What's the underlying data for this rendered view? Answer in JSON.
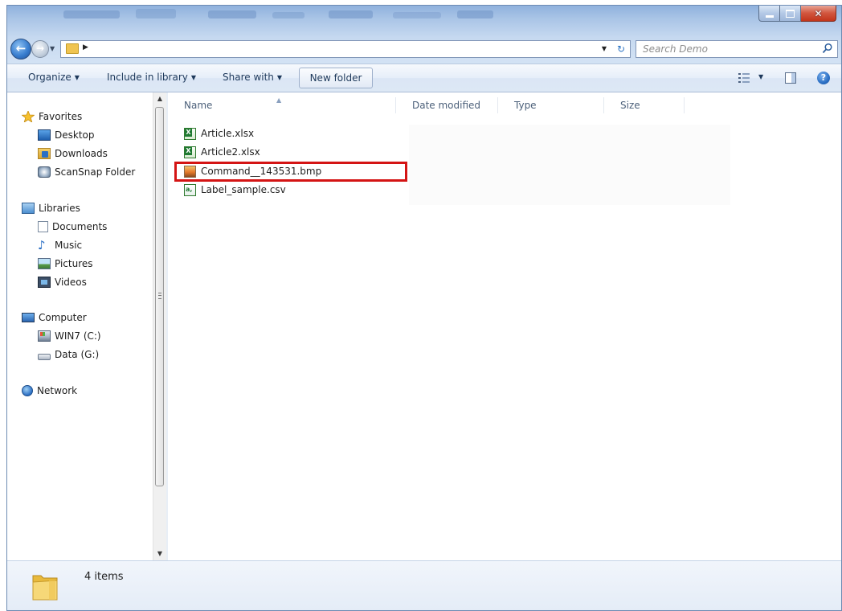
{
  "search": {
    "placeholder": "Search Demo"
  },
  "toolbar": {
    "organize": "Organize",
    "include_in_library": "Include in library",
    "share_with": "Share with",
    "new_folder": "New folder"
  },
  "nav": {
    "favorites": {
      "label": "Favorites",
      "items": [
        "Desktop",
        "Downloads",
        "ScanSnap Folder"
      ]
    },
    "libraries": {
      "label": "Libraries",
      "items": [
        "Documents",
        "Music",
        "Pictures",
        "Videos"
      ]
    },
    "computer": {
      "label": "Computer",
      "items": [
        "WIN7 (C:)",
        "Data (G:)"
      ]
    },
    "network": {
      "label": "Network"
    }
  },
  "columns": [
    "Name",
    "Date modified",
    "Type",
    "Size"
  ],
  "files": [
    {
      "name": "Article.xlsx",
      "icon": "excel-file-icon"
    },
    {
      "name": "Article2.xlsx",
      "icon": "excel-file-icon"
    },
    {
      "name": "Command__143531.bmp",
      "icon": "bitmap-file-icon",
      "highlighted": true
    },
    {
      "name": "Label_sample.csv",
      "icon": "csv-file-icon"
    }
  ],
  "status": {
    "item_count": "4 items"
  },
  "colors": {
    "highlight": "#d41414",
    "accent": "#2b6fc4"
  }
}
